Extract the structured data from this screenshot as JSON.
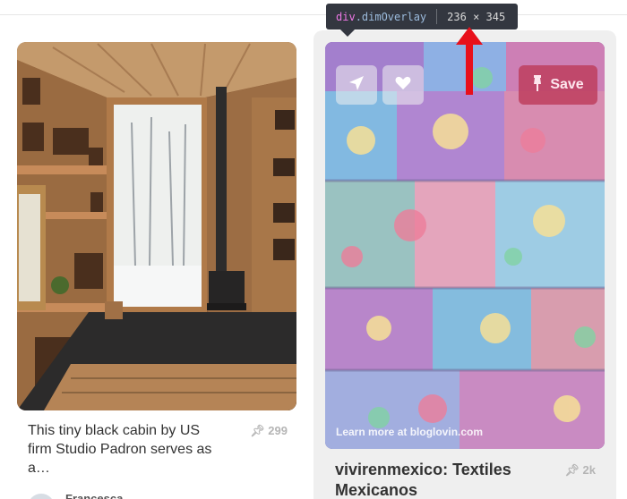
{
  "tooltip": {
    "tag": "div",
    "class": ".dimOverlay",
    "size": "236 × 345",
    "pointer_arrow_color": "#e8101b"
  },
  "pins": {
    "left": {
      "description": "This tiny black cabin by US firm Studio Padron serves as a…",
      "repin_count": "299",
      "pinner_name": "Francesca",
      "image_alt": "cabin-interior-photo"
    },
    "right": {
      "title": "vivirenmexico: Textiles Mexicanos",
      "repin_count": "2k",
      "save_label": "Save",
      "learn_more": "Learn more at bloglovin.com",
      "send_icon": "send-icon",
      "like_icon": "heart-icon",
      "save_color": "#bd3c5a",
      "image_alt": "mexican-textiles-photo"
    }
  }
}
